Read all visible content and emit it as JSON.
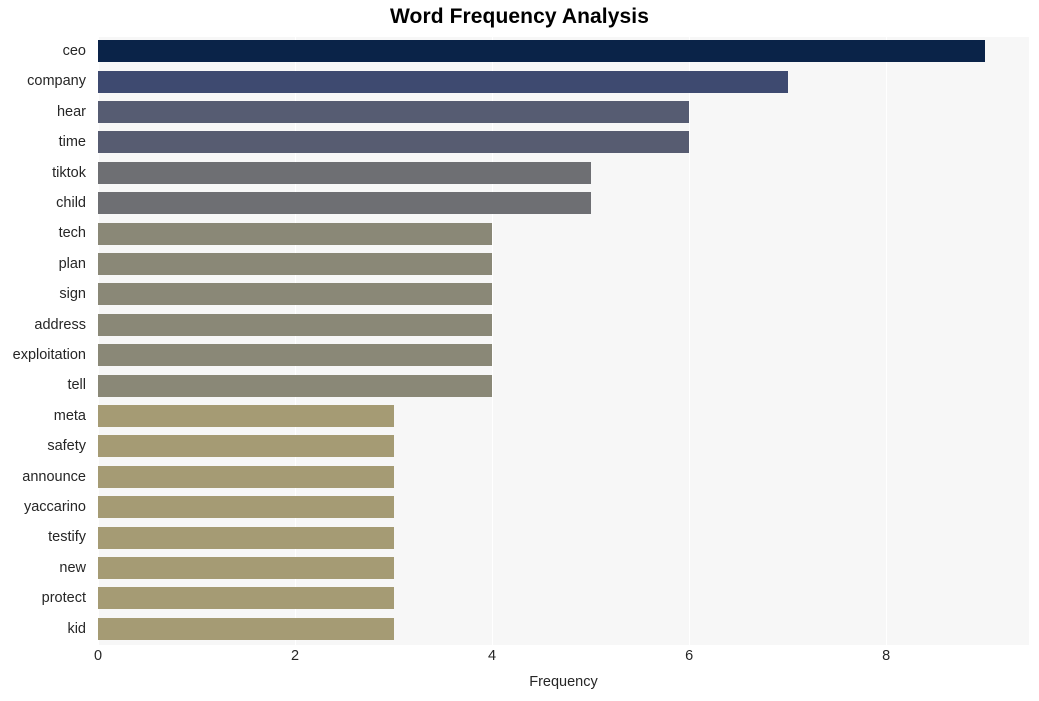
{
  "chart_data": {
    "type": "bar",
    "orientation": "horizontal",
    "title": "Word Frequency Analysis",
    "xlabel": "Frequency",
    "ylabel": "",
    "categories": [
      "ceo",
      "company",
      "hear",
      "time",
      "tiktok",
      "child",
      "tech",
      "plan",
      "sign",
      "address",
      "exploitation",
      "tell",
      "meta",
      "safety",
      "announce",
      "yaccarino",
      "testify",
      "new",
      "protect",
      "kid"
    ],
    "values": [
      9,
      7,
      6,
      6,
      5,
      5,
      4,
      4,
      4,
      4,
      4,
      4,
      3,
      3,
      3,
      3,
      3,
      3,
      3,
      3
    ],
    "bar_colors": [
      "#0a2348",
      "#3e4a70",
      "#565c72",
      "#575c71",
      "#6e6f73",
      "#6e6f73",
      "#8a8877",
      "#8a8877",
      "#8a8877",
      "#8a8877",
      "#8a8877",
      "#8a8877",
      "#a59b74",
      "#a59b74",
      "#a59b74",
      "#a59b74",
      "#a59b74",
      "#a59b74",
      "#a59b74",
      "#a59b74"
    ],
    "xticks": [
      0,
      2,
      4,
      6,
      8
    ],
    "xtick_labels": [
      "0",
      "2",
      "4",
      "6",
      "8"
    ],
    "xlim": [
      0,
      9.45
    ],
    "grid": true,
    "grid_color": "#ffffff",
    "plot_background": "#f7f7f7",
    "figure_background": "#ffffff",
    "legend": null,
    "legend_position": "none"
  }
}
